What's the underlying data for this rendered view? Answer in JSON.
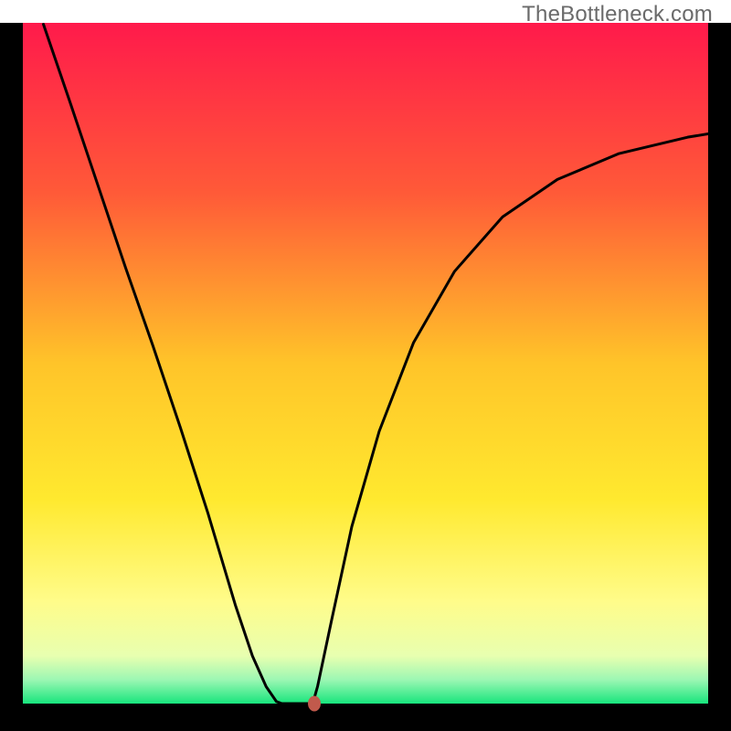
{
  "watermark": "TheBottleneck.com",
  "chart_data": {
    "type": "line",
    "title": "",
    "xlabel": "",
    "ylabel": "",
    "xlim": [
      0,
      100
    ],
    "ylim": [
      0,
      100
    ],
    "grid": false,
    "background_gradient": {
      "stops": [
        {
          "pos": 0.0,
          "color": "#ff1a4b"
        },
        {
          "pos": 0.25,
          "color": "#ff5a38"
        },
        {
          "pos": 0.5,
          "color": "#ffc429"
        },
        {
          "pos": 0.7,
          "color": "#ffe92f"
        },
        {
          "pos": 0.85,
          "color": "#fffc8a"
        },
        {
          "pos": 0.93,
          "color": "#e8ffb0"
        },
        {
          "pos": 0.965,
          "color": "#9cf7b3"
        },
        {
          "pos": 1.0,
          "color": "#18e57d"
        }
      ]
    },
    "series": [
      {
        "name": "curve",
        "color": "#000000",
        "x": [
          3,
          7,
          11,
          15,
          19,
          23,
          27,
          31,
          33.5,
          35.5,
          37,
          37.8,
          42.3,
          43,
          45,
          48,
          52,
          57,
          63,
          70,
          78,
          87,
          97,
          100
        ],
        "y": [
          99.8,
          88,
          76,
          64,
          52.5,
          40.5,
          28,
          14.5,
          7,
          2.5,
          0.3,
          0,
          0,
          2.5,
          12,
          26,
          40,
          53,
          63.5,
          71.5,
          77,
          80.8,
          83.2,
          83.7
        ]
      }
    ],
    "marker": {
      "x": 42.5,
      "y": 0,
      "color": "#c15a4c"
    }
  }
}
